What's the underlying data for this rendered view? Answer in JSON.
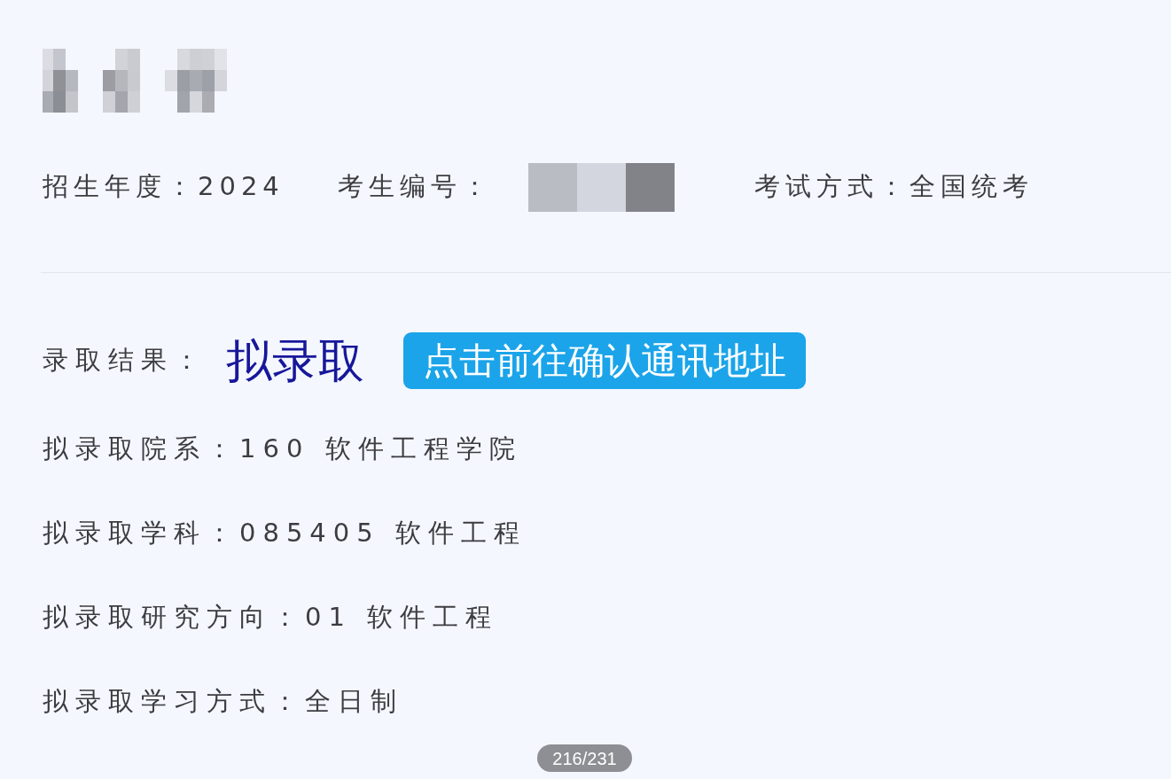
{
  "candidate": {
    "fields": [
      {
        "kind": "text",
        "label": "招生年度：",
        "value": "2024"
      },
      {
        "kind": "redacted",
        "label": "考生编号："
      },
      {
        "kind": "text",
        "label": "考试方式：",
        "value": "全国统考"
      }
    ]
  },
  "admission": {
    "result_label": "录取结果：",
    "result": "拟录取",
    "confirm_button": "点击前往确认通讯地址",
    "details": [
      {
        "label": "拟录取院系：",
        "value": "160 软件工程学院"
      },
      {
        "label": "拟录取学科：",
        "value": "085405 软件工程"
      },
      {
        "label": "拟录取研究方向：",
        "value": "01 软件工程"
      },
      {
        "label": "拟录取学习方式：",
        "value": "全日制"
      }
    ]
  },
  "page_indicator": "216/231"
}
